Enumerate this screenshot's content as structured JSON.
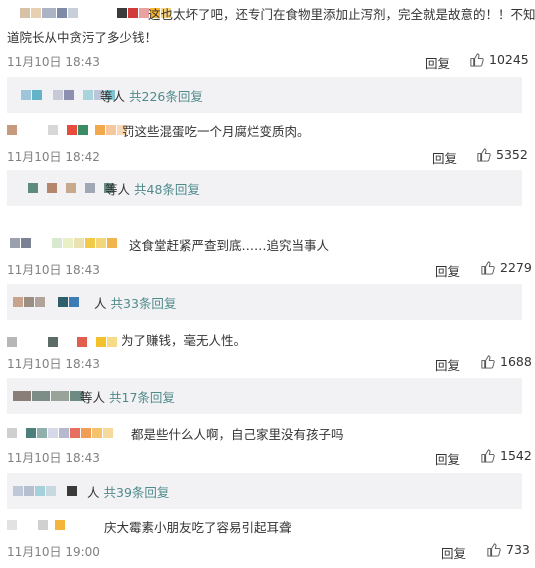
{
  "comments": [
    {
      "text1": "这也太坏了吧，还专门在食物里添加止泻剂，完全就是故意的！！不知",
      "text2": "道院长从中贪污了多少钱！",
      "time": "11月10日 18:43",
      "reply": "回复",
      "likes": "10245",
      "sub_tail": "等人",
      "sub_count": "共226条回复"
    },
    {
      "text1": "罚这些混蛋吃一个月腐烂变质肉。",
      "time": "11月10日 18:42",
      "reply": "回复",
      "likes": "5352",
      "sub_tail": "等人",
      "sub_count": "共48条回复"
    },
    {
      "text1": "这食堂赶紧严查到底……追究当事人",
      "time": "11月10日 18:43",
      "reply": "回复",
      "likes": "2279",
      "sub_tail": "人",
      "sub_count": "共33条回复"
    },
    {
      "text1": "为了赚钱，毫无人性。",
      "time": "11月10日 18:43",
      "reply": "回复",
      "likes": "1688",
      "sub_tail": "等人",
      "sub_count": "共17条回复"
    },
    {
      "text1": "都是些什么人啊，自己家里没有孩子吗",
      "time": "11月10日 18:43",
      "reply": "回复",
      "likes": "1542",
      "sub_tail": "人",
      "sub_count": "共39条回复"
    },
    {
      "text1": "庆大霉素小朋友吃了容易引起耳聋",
      "time": "11月10日 19:00",
      "reply": "回复",
      "likes": "733"
    }
  ],
  "colors": {
    "link": "#4f8a8b",
    "subbox_bg": "#f2f2f5",
    "time": "#808080"
  },
  "icons": [
    "thumbs-up-icon",
    "pixelated-username"
  ]
}
